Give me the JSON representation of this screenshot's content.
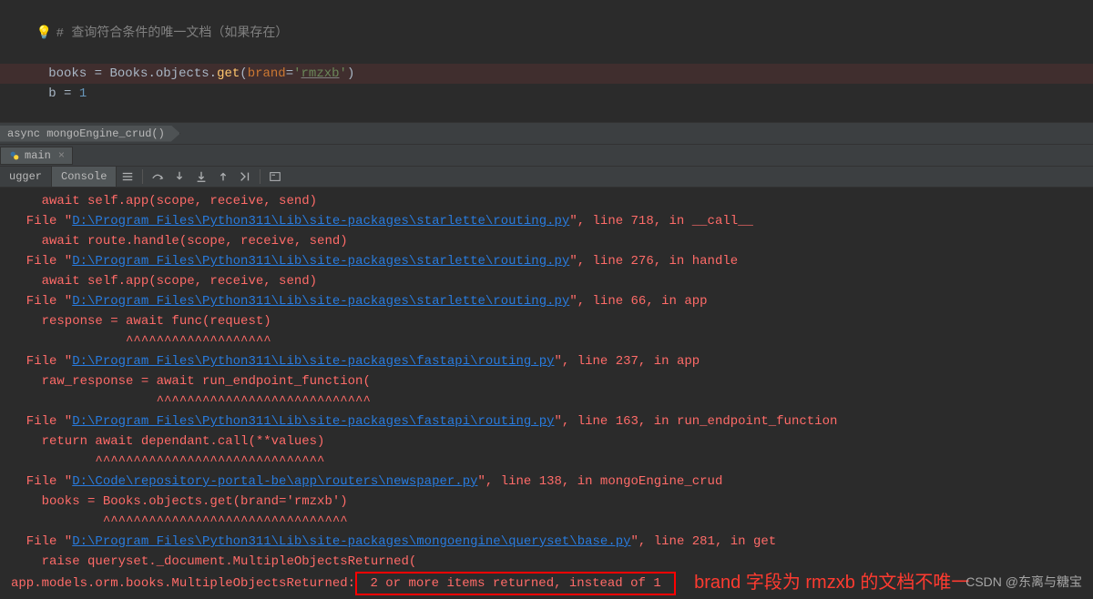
{
  "editor": {
    "comment_line": "# 查询符合条件的唯一文档（如果存在）",
    "code_line1": {
      "var": "books",
      "eq": " = ",
      "obj": "Books.objects.",
      "method": "get",
      "open": "(",
      "kwarg": "brand",
      "assign": "=",
      "str_open": "'",
      "str_val": "rmzxb",
      "str_close": "'",
      "close": ")"
    },
    "code_line2": {
      "var": "b",
      "eq": " = ",
      "num": "1"
    }
  },
  "breadcrumb": {
    "item": "async mongoEngine_crud()"
  },
  "file_tab": {
    "name": "main"
  },
  "debug_tabs": {
    "debugger": "ugger",
    "console": "Console"
  },
  "console_lines": [
    {
      "indent": "    ",
      "text": "await self.app(scope, receive, send)"
    },
    {
      "indent": "  ",
      "prefix": "File \"",
      "link": "D:\\Program Files\\Python311\\Lib\\site-packages\\starlette\\routing.py",
      "suffix": "\", line 718, in __call__"
    },
    {
      "indent": "    ",
      "text": "await route.handle(scope, receive, send)"
    },
    {
      "indent": "  ",
      "prefix": "File \"",
      "link": "D:\\Program Files\\Python311\\Lib\\site-packages\\starlette\\routing.py",
      "suffix": "\", line 276, in handle"
    },
    {
      "indent": "    ",
      "text": "await self.app(scope, receive, send)"
    },
    {
      "indent": "  ",
      "prefix": "File \"",
      "link": "D:\\Program Files\\Python311\\Lib\\site-packages\\starlette\\routing.py",
      "suffix": "\", line 66, in app"
    },
    {
      "indent": "    ",
      "text": "response = await func(request)"
    },
    {
      "indent": "               ",
      "text": "^^^^^^^^^^^^^^^^^^^"
    },
    {
      "indent": "  ",
      "prefix": "File \"",
      "link": "D:\\Program Files\\Python311\\Lib\\site-packages\\fastapi\\routing.py",
      "suffix": "\", line 237, in app"
    },
    {
      "indent": "    ",
      "text": "raw_response = await run_endpoint_function("
    },
    {
      "indent": "                   ",
      "text": "^^^^^^^^^^^^^^^^^^^^^^^^^^^^"
    },
    {
      "indent": "  ",
      "prefix": "File \"",
      "link": "D:\\Program Files\\Python311\\Lib\\site-packages\\fastapi\\routing.py",
      "suffix": "\", line 163, in run_endpoint_function"
    },
    {
      "indent": "    ",
      "text": "return await dependant.call(**values)"
    },
    {
      "indent": "           ",
      "text": "^^^^^^^^^^^^^^^^^^^^^^^^^^^^^^"
    },
    {
      "indent": "  ",
      "prefix": "File \"",
      "link": "D:\\Code\\repository-portal-be\\app\\routers\\newspaper.py",
      "suffix": "\", line 138, in mongoEngine_crud"
    },
    {
      "indent": "    ",
      "text": "books = Books.objects.get(brand='rmzxb')"
    },
    {
      "indent": "            ",
      "text": "^^^^^^^^^^^^^^^^^^^^^^^^^^^^^^^^"
    },
    {
      "indent": "  ",
      "prefix": "File \"",
      "link": "D:\\Program Files\\Python311\\Lib\\site-packages\\mongoengine\\queryset\\base.py",
      "suffix": "\", line 281, in get"
    },
    {
      "indent": "    ",
      "text": "raise queryset._document.MultipleObjectsReturned("
    }
  ],
  "error_line": {
    "prefix": "app.models.orm.books.MultipleObjectsReturned:",
    "boxed": " 2 or more items returned, instead of 1 ",
    "annotation": "brand 字段为 rmzxb 的文档不唯一"
  },
  "watermark": "CSDN @东离与糖宝"
}
